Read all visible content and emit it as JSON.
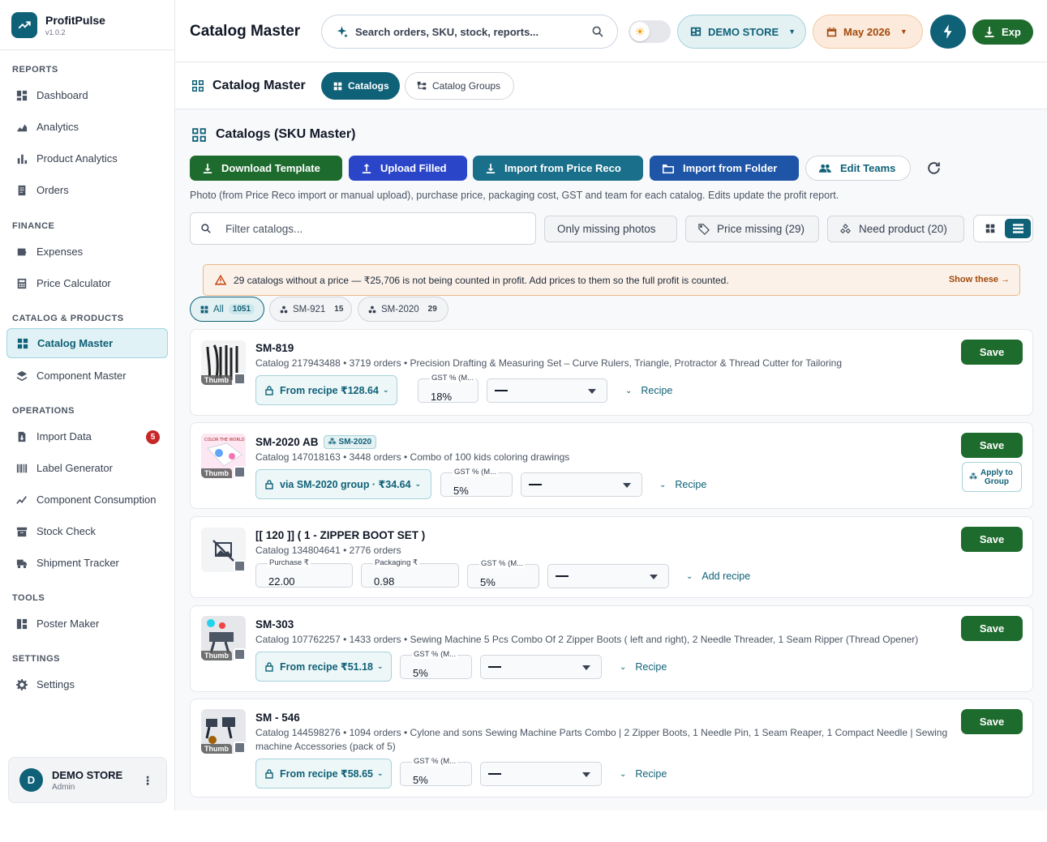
{
  "brand": {
    "name": "ProfitPulse",
    "version": "v1.0.2"
  },
  "sidebar": {
    "sections": [
      {
        "title": "REPORTS",
        "items": [
          {
            "label": "Dashboard",
            "icon": "dashboard-icon"
          },
          {
            "label": "Analytics",
            "icon": "analytics-icon"
          },
          {
            "label": "Product Analytics",
            "icon": "bar-chart-icon"
          },
          {
            "label": "Orders",
            "icon": "orders-icon"
          }
        ]
      },
      {
        "title": "FINANCE",
        "items": [
          {
            "label": "Expenses",
            "icon": "wallet-icon"
          },
          {
            "label": "Price Calculator",
            "icon": "calculator-icon"
          }
        ]
      },
      {
        "title": "CATALOG & PRODUCTS",
        "items": [
          {
            "label": "Catalog Master",
            "icon": "grid-icon",
            "active": true
          },
          {
            "label": "Component Master",
            "icon": "layers-icon"
          }
        ]
      },
      {
        "title": "OPERATIONS",
        "items": [
          {
            "label": "Import Data",
            "icon": "file-import-icon",
            "badge": "5"
          },
          {
            "label": "Label Generator",
            "icon": "barcode-icon"
          },
          {
            "label": "Component Consumption",
            "icon": "trend-icon"
          },
          {
            "label": "Stock Check",
            "icon": "archive-icon"
          },
          {
            "label": "Shipment Tracker",
            "icon": "truck-icon"
          }
        ]
      },
      {
        "title": "TOOLS",
        "items": [
          {
            "label": "Poster Maker",
            "icon": "poster-icon"
          }
        ]
      },
      {
        "title": "SETTINGS",
        "items": [
          {
            "label": "Settings",
            "icon": "gear-icon"
          }
        ]
      }
    ],
    "user": {
      "initial": "D",
      "name": "DEMO STORE",
      "role": "Admin"
    }
  },
  "topbar": {
    "title": "Catalog Master",
    "search_placeholder": "Search orders, SKU, stock, reports...",
    "store_label": "DEMO STORE",
    "month_label": "May 2026",
    "export_label": "Exp"
  },
  "subbar": {
    "title": "Catalog Master",
    "tabs": [
      {
        "label": "Catalogs",
        "active": true
      },
      {
        "label": "Catalog Groups"
      }
    ]
  },
  "main": {
    "section_title": "Catalogs (SKU Master)",
    "actions": {
      "download_template": "Download Template",
      "upload_filled": "Upload Filled",
      "import_price_reco": "Import from Price Reco",
      "import_folder": "Import from Folder",
      "edit_teams": "Edit Teams"
    },
    "description": "Photo (from Price Reco import or manual upload), purchase price, packaging cost, GST and team for each catalog. Edits update the profit report.",
    "filter_placeholder": "Filter catalogs...",
    "chips": {
      "missing_photos": "Only missing photos",
      "price_missing": "Price missing (29)",
      "need_product": "Need product (20)"
    },
    "warning": {
      "text": "29 catalogs without a price — ₹25,706 is not being counted in profit. Add prices to them so the full profit is counted.",
      "link": "Show these →"
    },
    "group_tabs": [
      {
        "label": "All",
        "count": "1051"
      },
      {
        "label": "SM-921",
        "count": "15"
      },
      {
        "label": "SM-2020",
        "count": "29"
      }
    ],
    "save_label": "Save",
    "thumb_label": "Thumb",
    "catalogs": [
      {
        "sku": "SM-819",
        "meta": "Catalog 217943488  •  3719 orders  •  Precision Drafting & Measuring Set – Curve Rulers, Triangle, Protractor & Thread Cutter for Tailoring",
        "recipe": "From recipe ₹128.64",
        "gst_label": "GST % (M...",
        "gst": "18%",
        "link": "Recipe"
      },
      {
        "sku": "SM-2020 AB",
        "group_badge": "SM-2020",
        "meta": "Catalog 147018163  •  3448 orders  •  Combo of  100 kids coloring drawings",
        "recipe": "via SM-2020 group · ₹34.64",
        "gst_label": "GST % (M...",
        "gst": "5%",
        "link": "Recipe",
        "apply": "Apply to Group"
      },
      {
        "sku": "[[ 120 ]] ( 1 - ZIPPER BOOT SET )",
        "meta": "Catalog 134804641  •  2776 orders",
        "purchase_label": "Purchase ₹",
        "purchase": "22.00",
        "packaging_label": "Packaging ₹",
        "packaging": "0.98",
        "gst_label": "GST % (M...",
        "gst": "5%",
        "link": "Add recipe"
      },
      {
        "sku": "SM-303",
        "meta": "Catalog 107762257  •  1433 orders  •  Sewing Machine 5 Pcs Combo Of 2 Zipper Boots ( left and right), 2 Needle Threader, 1 Seam Ripper (Thread Opener)",
        "recipe": "From recipe ₹51.18",
        "gst_label": "GST % (M...",
        "gst": "5%",
        "link": "Recipe"
      },
      {
        "sku": "SM - 546",
        "meta": "Catalog 144598276  •  1094 orders  •  Cylone and sons Sewing Machine Parts Combo | 2 Zipper Boots, 1 Needle Pin, 1 Seam Reaper, 1 Compact Needle | Sewing machine Accessories (pack of 5)",
        "recipe": "From recipe ₹58.65",
        "gst_label": "GST % (M...",
        "gst": "5%",
        "link": "Recipe"
      }
    ]
  },
  "colors": {
    "primary": "#0f6178",
    "success": "#1e6b2e",
    "upload": "#2b45c9",
    "import_price": "#1a6f8a",
    "import_folder": "#1f55a6",
    "warning_bg": "#fbf1e9"
  }
}
